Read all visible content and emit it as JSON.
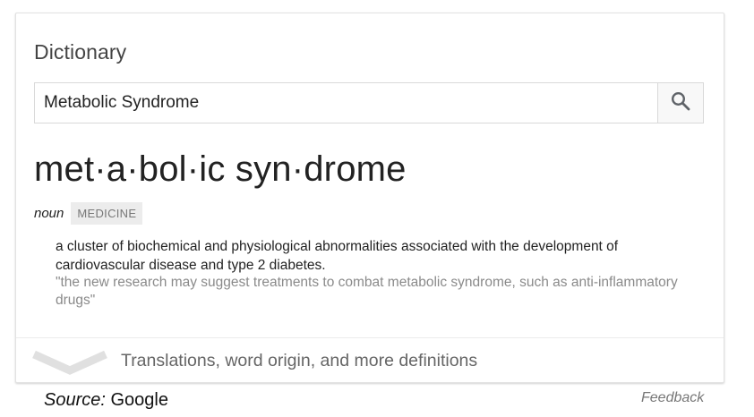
{
  "card": {
    "title": "Dictionary",
    "search": {
      "value": "Metabolic Syndrome",
      "button_icon": "search-icon"
    },
    "entry": {
      "headword": "met·a·bol·ic syn·drome",
      "part_of_speech": "noun",
      "domain_label": "MEDICINE",
      "definition": "a cluster of biochemical and physiological abnormalities associated with the development of cardiovascular disease and type 2 diabetes.",
      "example": "\"the new research may suggest treatments to combat metabolic syndrome, such as anti-inflammatory drugs\""
    },
    "more": {
      "label": "Translations, word origin, and more definitions",
      "icon": "chevron-down-icon"
    }
  },
  "footer": {
    "source_prefix": "Source:",
    "source_name": "Google",
    "feedback": "Feedback"
  },
  "colors": {
    "text": "#222222",
    "muted": "#8a8a8a",
    "tag_bg": "#ececec",
    "chevron": "#e0e0e0"
  }
}
